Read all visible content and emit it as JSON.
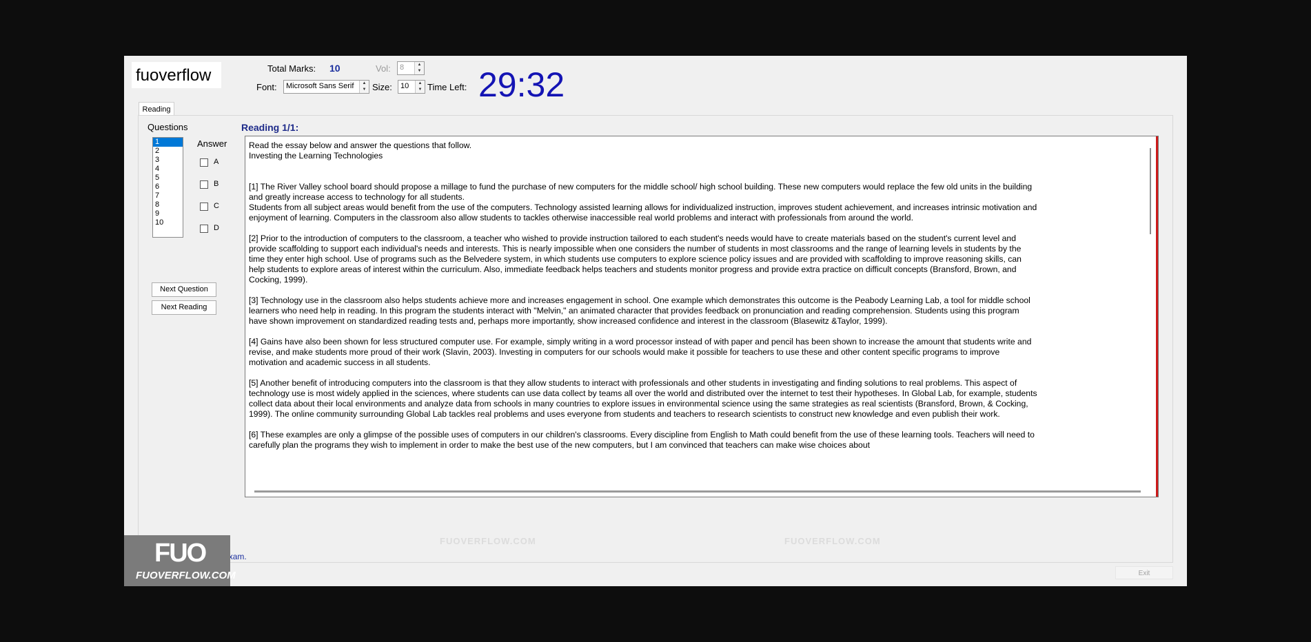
{
  "logo": {
    "text": "fuoverflow"
  },
  "header": {
    "total_marks_label": "Total Marks:",
    "total_marks_value": "10",
    "vol_label": "Vol:",
    "vol_value": "8",
    "font_label": "Font:",
    "font_value": "Microsoft Sans Serif",
    "size_label": "Size:",
    "size_value": "10",
    "time_left_label": "Time Left:",
    "timer": "29:32"
  },
  "tab": {
    "label": "Reading"
  },
  "questions": {
    "label": "Questions",
    "items": [
      "1",
      "2",
      "3",
      "4",
      "5",
      "6",
      "7",
      "8",
      "9",
      "10"
    ],
    "selected_index": 0
  },
  "answer": {
    "label": "Answer",
    "options": [
      "A",
      "B",
      "C",
      "D"
    ]
  },
  "buttons": {
    "next_question": "Next Question",
    "next_reading": "Next Reading",
    "exit": "Exit"
  },
  "reading": {
    "title": "Reading 1/1:",
    "intro": "Read the essay below and answer the questions that follow.",
    "essay_title": "Investing the Learning Technologies",
    "paragraphs": [
      "[1] The River Valley school board should propose a millage to fund the purchase of new computers for the middle school/ high school building. These new computers would replace the few old units in the building and greatly increase access to technology for all students.\nStudents from all subject areas would benefit from the use of the computers. Technology assisted learning allows for individualized instruction, improves student achievement, and increases intrinsic motivation and enjoyment of learning. Computers in the classroom also allow students to tackles otherwise inaccessible real world problems and interact with professionals from around the world.",
      "[2] Prior to the introduction of computers to the classroom, a teacher who wished to provide instruction tailored to each student's needs would have to create materials based on the student's current level and provide scaffolding to support each individual's needs and interests. This is nearly impossible when one considers the number of students in most classrooms and the range of learning levels in students by the time they enter high school. Use of programs such as the Belvedere system, in which students use computers to explore science policy issues and are provided with scaffolding to improve reasoning skills, can help  students to explore areas of interest within the curriculum. Also, immediate feedback helps teachers and students monitor progress and provide extra practice on difficult concepts (Bransford, Brown, and Cocking, 1999).",
      "[3] Technology use in the classroom also helps students achieve more and increases engagement in school. One example which demonstrates this outcome is the Peabody Learning Lab, a tool for middle school learners who need help in reading. In this program the students interact with \"Melvin,\" an animated character that provides feedback on pronunciation and reading comprehension. Students using this program have shown improvement on standardized reading tests and, perhaps more importantly, show increased confidence and interest in the classroom (Blasewitz &Taylor, 1999).",
      "[4] Gains have also been shown for less structured computer use. For example, simply writing in a word processor instead of with paper and pencil has been shown to increase the amount that students write and revise, and make students more proud of their work (Slavin, 2003). Investing in computers for our schools would make it possible for teachers to use these and other content specific programs to improve motivation and academic success in all students.",
      "[5] Another benefit of introducing computers into the classroom is that they allow students to interact with professionals and other students in investigating and finding solutions to real problems. This aspect of technology use is most widely applied in the sciences, where students can use data collect by teams all over the world and distributed over the internet to test their hypotheses. In Global Lab, for example, students collect data about their local environments and analyze data from schools in many countries to explore issues in environmental science using the same strategies as real scientists (Bransford, Brown, & Cocking, 1999). The online community surrounding Global Lab tackles real problems and uses everyone from students and teachers to research scientists to construct new knowledge and even publish their work.",
      "[6] These examples are only a glimpse of the possible uses of computers in our children's classrooms. Every discipline from English to Math could benefit from the use of these learning tools. Teachers will need to carefully plan the programs they wish to implement in order to make the best use of the new computers, but I am convinced that teachers can make wise choices about"
    ]
  },
  "watermark": {
    "text_1": "FUOVERFLOW.COM",
    "text_2": "FUOVERFLOW.COM"
  },
  "badge": {
    "big": "FUO",
    "small": "FUOVERFLOW.COM"
  },
  "finish": {
    "label": "I want to finish the exam."
  }
}
